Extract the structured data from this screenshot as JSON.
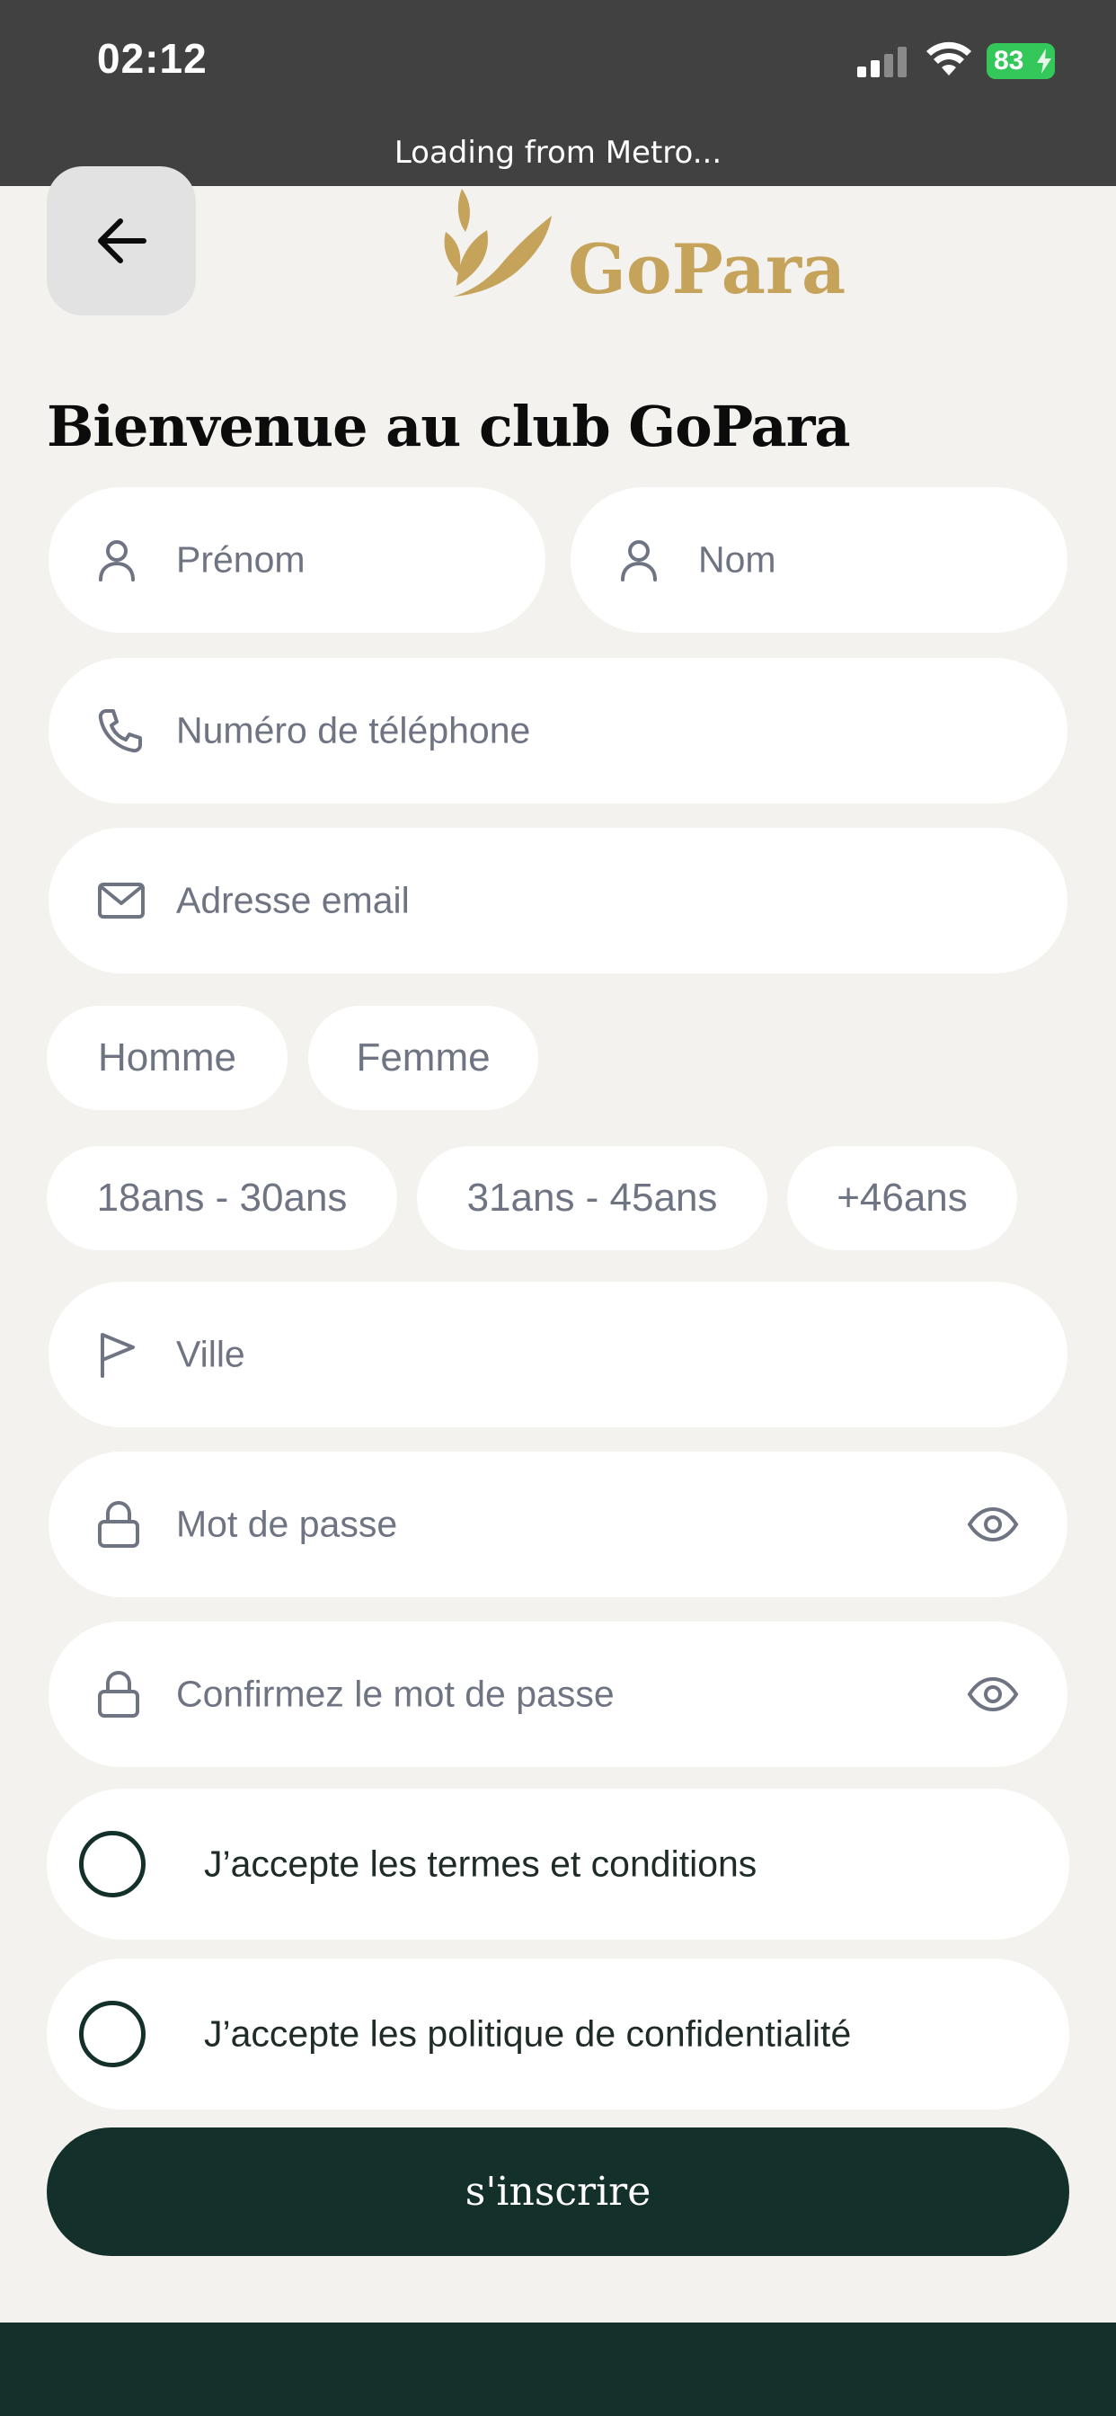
{
  "status_bar": {
    "time": "02:12",
    "loading_text": "Loading from Metro...",
    "battery": "83"
  },
  "header": {
    "back_icon": "arrow-left-icon",
    "logo_text": "GoPara"
  },
  "page": {
    "title": "Bienvenue au club GoPara"
  },
  "form": {
    "first_name_placeholder": "Prénom",
    "last_name_placeholder": "Nom",
    "phone_placeholder": "Numéro de téléphone",
    "email_placeholder": "Adresse email",
    "gender_options": [
      "Homme",
      "Femme"
    ],
    "age_options": [
      "18ans - 30ans",
      "31ans - 45ans",
      "+46ans"
    ],
    "city_placeholder": "Ville",
    "password_placeholder": "Mot de passe",
    "confirm_password_placeholder": "Confirmez le mot de passe",
    "terms_label": "J’accepte les termes et conditions",
    "privacy_label": "J’accepte les politique de confidentialité",
    "submit_label": "s'inscrire"
  },
  "colors": {
    "background": "#f3f2ef",
    "primary_dark_green": "#14302a",
    "logo_gold": "#c5a35a",
    "placeholder_gray": "#6f7482",
    "status_bar": "#414141",
    "battery_green": "#34c759"
  }
}
